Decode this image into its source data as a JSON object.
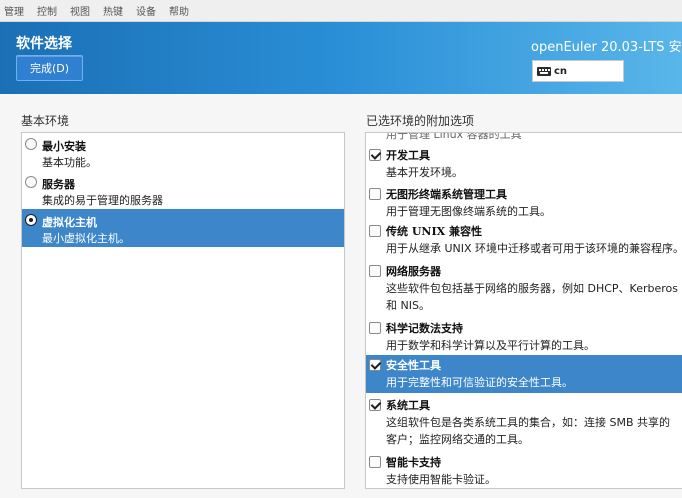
{
  "menubar": {
    "items": [
      "管理",
      "控制",
      "视图",
      "热键",
      "设备",
      "帮助"
    ]
  },
  "header": {
    "title": "软件选择",
    "done_label": "完成(D)",
    "product": "openEuler 20.03-LTS 安",
    "keyboard": "cn"
  },
  "left": {
    "heading": "基本环境",
    "items": [
      {
        "title": "最小安装",
        "desc": "基本功能。",
        "selected": false
      },
      {
        "title": "服务器",
        "desc": "集成的易于管理的服务器",
        "selected": false
      },
      {
        "title": "虚拟化主机",
        "desc": "最小虚拟化主机。",
        "selected": true
      }
    ]
  },
  "right": {
    "heading": "已选环境的附加选项",
    "partial_text": "用于管理 Linux 容器的工具",
    "items": [
      {
        "title": "开发工具",
        "desc": "基本开发环境。",
        "checked": true
      },
      {
        "title": "无图形终端系统管理工具",
        "desc": "用于管理无图像终端系统的工具。",
        "checked": false
      },
      {
        "title": "传统 UNIX 兼容性",
        "desc": "用于从继承 UNIX 环境中迁移或者可用于该环境的兼容程序。",
        "checked": false
      },
      {
        "title": "网络服务器",
        "desc": "这些软件包包括基于网络的服务器，例如 DHCP、Kerberos 和 NIS。",
        "checked": false
      },
      {
        "title": "科学记数法支持",
        "desc": "用于数学和科学计算以及平行计算的工具。",
        "checked": false
      },
      {
        "title": "安全性工具",
        "desc": "用于完整性和可信验证的安全性工具。",
        "checked": true
      },
      {
        "title": "系统工具",
        "desc": "这组软件包是各类系统工具的集合，如：连接 SMB 共享的客户；监控网络交通的工具。",
        "checked": true
      },
      {
        "title": "智能卡支持",
        "desc": "支持使用智能卡验证。",
        "checked": false
      }
    ]
  }
}
